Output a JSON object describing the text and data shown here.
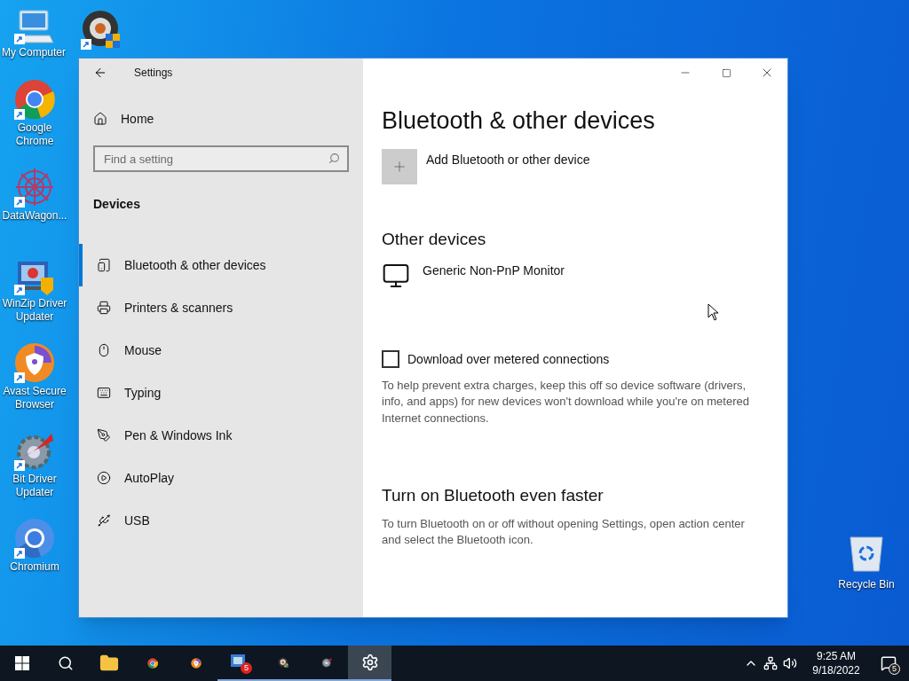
{
  "desktop_top_icons": [
    {
      "label": "My Computer",
      "kind": "computer"
    },
    {
      "kind": "gear-badge"
    }
  ],
  "desktop_icons": [
    {
      "label": "Google Chrome",
      "kind": "chrome"
    },
    {
      "label": "DataWagon...",
      "kind": "snowflake"
    },
    {
      "label": "WinZip Driver Updater",
      "kind": "winzip"
    },
    {
      "label": "Avast Secure Browser",
      "kind": "avast"
    },
    {
      "label": "Bit Driver Updater",
      "kind": "bitgear"
    },
    {
      "label": "Chromium",
      "kind": "chromium"
    }
  ],
  "recycle_bin": {
    "label": "Recycle Bin"
  },
  "window": {
    "title": "Settings",
    "sidebar": {
      "home": "Home",
      "search": {
        "placeholder": "Find a setting"
      },
      "section": "Devices",
      "items": [
        {
          "label": "Bluetooth & other devices",
          "kind": "bluetooth",
          "selected": true
        },
        {
          "label": "Printers & scanners",
          "kind": "printer",
          "selected": false
        },
        {
          "label": "Mouse",
          "kind": "mouse",
          "selected": false
        },
        {
          "label": "Typing",
          "kind": "keyboard",
          "selected": false
        },
        {
          "label": "Pen & Windows Ink",
          "kind": "pen",
          "selected": false
        },
        {
          "label": "AutoPlay",
          "kind": "autoplay",
          "selected": false
        },
        {
          "label": "USB",
          "kind": "usb",
          "selected": false
        }
      ]
    },
    "content": {
      "heading": "Bluetooth & other devices",
      "add_button": "Add Bluetooth or other device",
      "other_heading": "Other devices",
      "devices": [
        "Generic Non-PnP Monitor"
      ],
      "metered": {
        "label": "Download over metered connections",
        "checked": false
      },
      "metered_note": "To help prevent extra charges, keep this off so device software (drivers, info, and apps) for new devices won't download while you're on metered Internet connections.",
      "faster_heading": "Turn on Bluetooth even faster",
      "faster_note": "To turn Bluetooth on or off without opening Settings, open action center and select the Bluetooth icon."
    }
  },
  "taskbar": {
    "items": [
      {
        "kind": "start",
        "running": false,
        "active": false
      },
      {
        "kind": "search",
        "running": false,
        "active": false
      },
      {
        "kind": "folder",
        "running": false,
        "active": false
      },
      {
        "kind": "chrome",
        "running": false,
        "active": false
      },
      {
        "kind": "avast",
        "running": false,
        "active": false
      },
      {
        "kind": "badge-app",
        "running": true,
        "active": false,
        "badge": "5"
      },
      {
        "kind": "gear-badge",
        "running": true,
        "active": false
      },
      {
        "kind": "bitgear",
        "running": true,
        "active": false
      },
      {
        "kind": "settings",
        "running": true,
        "active": true
      }
    ],
    "time": "9:25 AM",
    "date": "9/18/2022",
    "notifications": "5"
  }
}
